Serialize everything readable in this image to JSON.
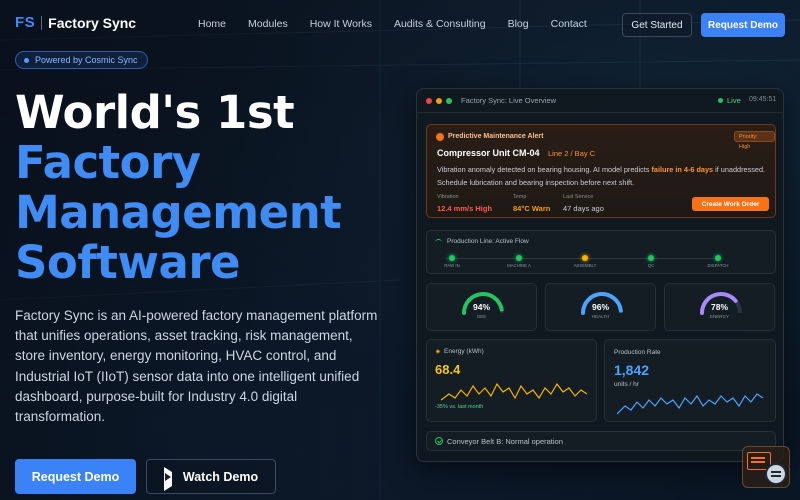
{
  "brand": {
    "mark": "FS",
    "name": "Factory Sync"
  },
  "nav": {
    "links": [
      "Home",
      "Modules",
      "How It Works",
      "Audits & Consulting",
      "Blog",
      "Contact"
    ],
    "get_started": "Get Started",
    "request_demo": "Request Demo"
  },
  "hero": {
    "badge": "Powered by Cosmic Sync",
    "title_line1": "World's 1st",
    "title_line2": "Factory",
    "title_line3": "Management",
    "title_line4": "Software",
    "description": "Factory Sync is an AI-powered factory management platform that unifies operations, asset tracking, risk management, store inventory, energy monitoring, HVAC control, and Industrial IoT (IIoT) sensor data into one intelligent unified dashboard, purpose-built for Industry 4.0 digital transformation.",
    "cta_demo": "Request Demo",
    "cta_watch": "Watch Demo"
  },
  "dashboard": {
    "title": "Factory Sync: Live Overview",
    "live": "Live",
    "time": "09:45:51",
    "alert": {
      "title": "Predictive Maintenance Alert",
      "priority": "Priority: High",
      "unit": "Compressor Unit CM-04",
      "location": "Line 2 / Bay C",
      "msg_pre": "Vibration anomaly detected on bearing housing. AI model predicts ",
      "msg_hl": "failure in 4-6 days",
      "msg_post": " if unaddressed. Schedule lubrication and bearing inspection before next shift.",
      "metrics": [
        {
          "label": "Vibration",
          "value": "12.4 mm/s High",
          "color": "#ff5a4f"
        },
        {
          "label": "Temp",
          "value": "84°C Warn",
          "color": "#f59e0b"
        },
        {
          "label": "Last Service",
          "value": "47 days ago",
          "color": "#c9ced6"
        }
      ],
      "action": "Create Work Order"
    },
    "production": {
      "title": "Production Line: Active Flow",
      "stations": [
        {
          "label": "RAW IN",
          "color": "#22c55e"
        },
        {
          "label": "MACHINE A",
          "color": "#22c55e"
        },
        {
          "label": "ASSEMBLY",
          "color": "#f5b300"
        },
        {
          "label": "QC",
          "color": "#22c55e"
        },
        {
          "label": "DISPATCH",
          "color": "#22c55e"
        }
      ]
    },
    "gauges": [
      {
        "value": "94%",
        "label": "OEE",
        "pct": 0.94,
        "color": "#22c55e"
      },
      {
        "value": "96%",
        "label": "HEALTH",
        "pct": 0.96,
        "color": "#4da3ff"
      },
      {
        "value": "78%",
        "label": "ENERGY",
        "pct": 0.78,
        "color": "#a78bfa"
      }
    ],
    "energy": {
      "title": "Energy (kWh)",
      "value": "68.4",
      "footer": "-35% vs. last month",
      "color": "#f5b300"
    },
    "rate": {
      "title": "Production Rate",
      "value": "1,842",
      "unit": "units / hr",
      "color": "#4da3ff"
    },
    "conveyor": "Conveyor Belt B: Normal operation"
  }
}
